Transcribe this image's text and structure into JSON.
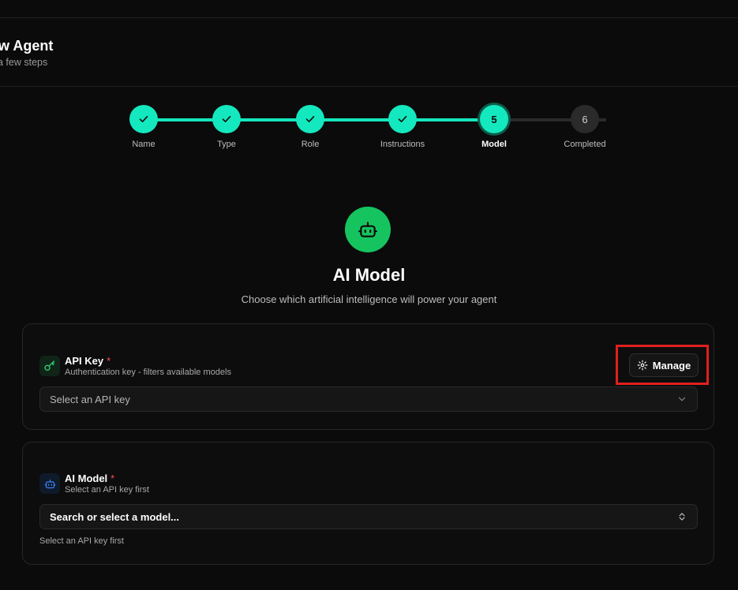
{
  "header": {
    "title": "w Agent",
    "subtitle": "a few steps"
  },
  "stepper": {
    "steps": [
      {
        "label": "Name",
        "state": "done",
        "number": "1"
      },
      {
        "label": "Type",
        "state": "done",
        "number": "2"
      },
      {
        "label": "Role",
        "state": "done",
        "number": "3"
      },
      {
        "label": "Instructions",
        "state": "done",
        "number": "4"
      },
      {
        "label": "Model",
        "state": "active",
        "number": "5"
      },
      {
        "label": "Completed",
        "state": "pending",
        "number": "6"
      }
    ],
    "accent_color": "#14e8be"
  },
  "hero": {
    "icon": "bot-icon",
    "title": "AI Model",
    "subtitle": "Choose which artificial intelligence will power your agent"
  },
  "api_key_card": {
    "icon": "key-icon",
    "label": "API Key",
    "required_mark": "*",
    "description": "Authentication key - filters available models",
    "manage_label": "Manage",
    "select_placeholder": "Select an API key"
  },
  "model_card": {
    "icon": "bot-icon",
    "label": "AI Model",
    "required_mark": "*",
    "description": "Select an API key first",
    "select_placeholder": "Search or select a model...",
    "helper": "Select an API key first"
  },
  "colors": {
    "background": "#0b0b0b",
    "accent": "#14e8be",
    "hero_green": "#16c45f",
    "required": "#ff4d4d",
    "highlight": "#e01f1f"
  }
}
